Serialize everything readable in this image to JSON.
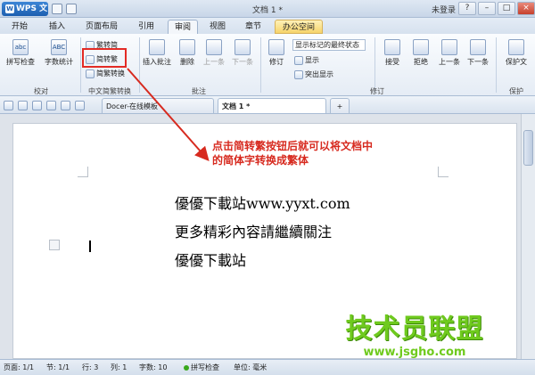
{
  "app": {
    "name": "WPS 文字",
    "logo": "W",
    "document_title": "文档 1 *",
    "login": "未登录",
    "colors": {
      "accent": "#1d5fb0",
      "annotation_red": "#d72a1f",
      "watermark_green": "#6fca1e"
    }
  },
  "window_controls": {
    "help": "?",
    "minimize": "–",
    "restore": "□",
    "close": "×"
  },
  "tabs": [
    {
      "label": "开始"
    },
    {
      "label": "插入"
    },
    {
      "label": "页面布局"
    },
    {
      "label": "引用"
    },
    {
      "label": "审阅"
    },
    {
      "label": "视图"
    },
    {
      "label": "章节"
    },
    {
      "label": "办公空间"
    }
  ],
  "ribbon": {
    "spellcheck_label": "拼写检查",
    "spellcheck_icon_text": "abc",
    "wordcount_label": "字数统计",
    "wordcount_icon_text": "ABC",
    "group_proofreading": "校对",
    "trad_to_simp": "繁转简",
    "simp_to_trad": "简转繁",
    "simp_trad_convert": "简繁转换",
    "group_chinese_conversion": "中文简繁转换",
    "insert_comment": "插入批注",
    "delete": "删除",
    "previous_comment": "上一条",
    "next_comment": "下一条",
    "group_comments": "批注",
    "track_changes": "修订",
    "display_state": "显示标记的最终状态",
    "show": "显示",
    "highlight_show": "突出显示",
    "accept": "接受",
    "reject": "拒绝",
    "previous_change": "上一条",
    "next_change": "下一条",
    "group_revision": "修订",
    "protect_doc": "保护文",
    "group_protect": "保护"
  },
  "doc_tabs": [
    {
      "label": "Docer-在线模板"
    },
    {
      "label": "文档 1 *"
    }
  ],
  "doc_tab_add": "+",
  "annotation": {
    "line1": "点击简转繁按钮后就可以将文档中",
    "line2": "的简体字转换成繁体"
  },
  "document": {
    "lines": [
      "優優下載站www.yyxt.com",
      "更多精彩內容請繼續關注",
      "優優下載站"
    ]
  },
  "watermark": {
    "big": "技术员联盟",
    "small": "www.jsgho.com"
  },
  "status": {
    "page": "页面: 1/1",
    "section": "节: 1/1",
    "row": "行: 3",
    "col": "列: 1",
    "word_count": "字数: 10",
    "spellcheck": "拼写检查",
    "unit": "单位: 毫米"
  }
}
